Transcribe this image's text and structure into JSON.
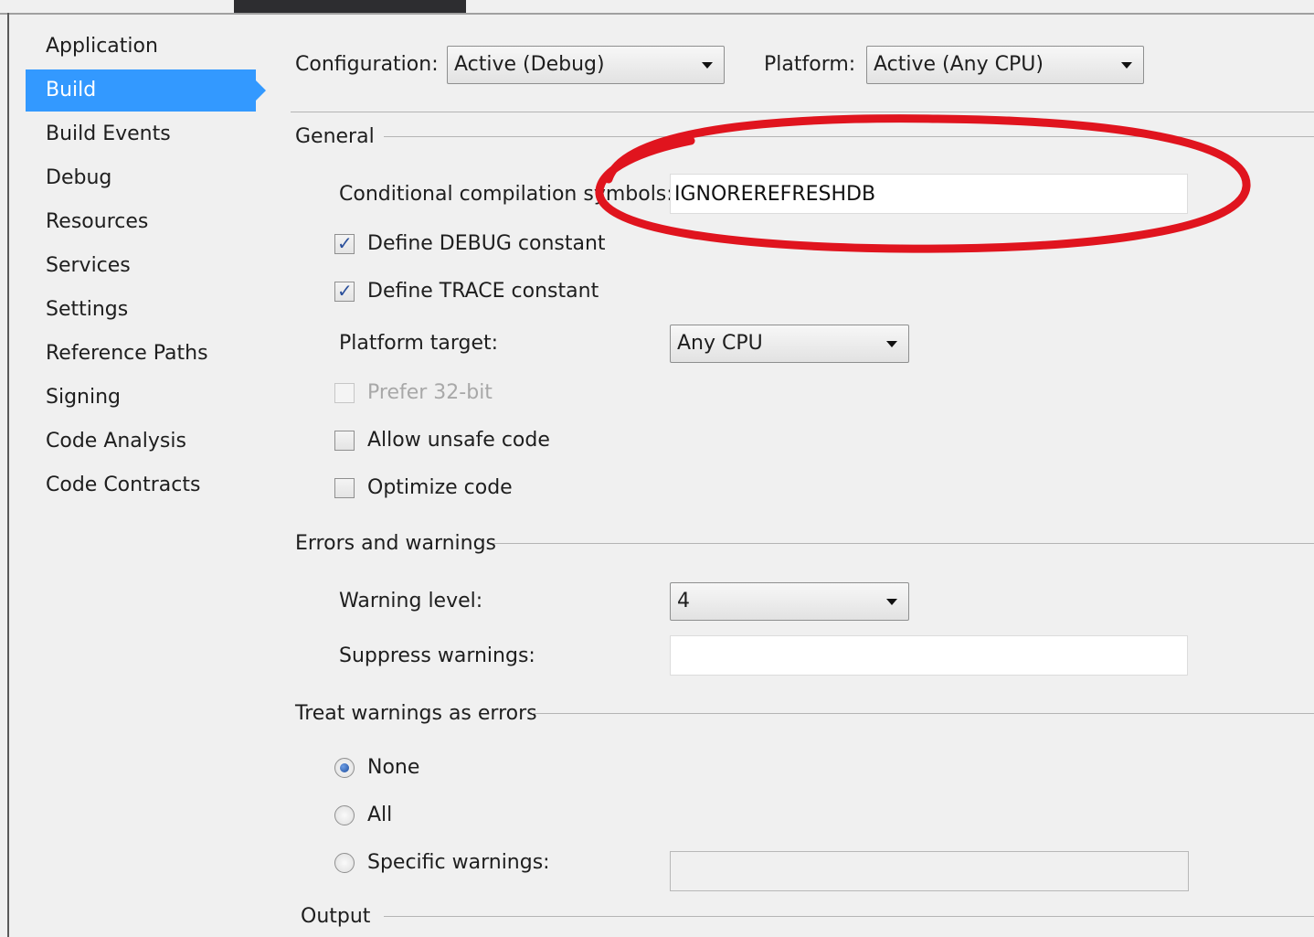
{
  "sidebar": {
    "items": [
      {
        "label": "Application"
      },
      {
        "label": "Build"
      },
      {
        "label": "Build Events"
      },
      {
        "label": "Debug"
      },
      {
        "label": "Resources"
      },
      {
        "label": "Services"
      },
      {
        "label": "Settings"
      },
      {
        "label": "Reference Paths"
      },
      {
        "label": "Signing"
      },
      {
        "label": "Code Analysis"
      },
      {
        "label": "Code Contracts"
      }
    ],
    "selected": "Build"
  },
  "toolbar": {
    "configuration_label": "Configuration:",
    "configuration_value": "Active (Debug)",
    "platform_label": "Platform:",
    "platform_value": "Active (Any CPU)"
  },
  "general": {
    "header": "General",
    "symbols_label": "Conditional compilation symbols:",
    "symbols_value": "IGNOREREFRESHDB",
    "define_debug_label": "Define DEBUG constant",
    "define_debug_checked": true,
    "define_trace_label": "Define TRACE constant",
    "define_trace_checked": true,
    "platform_target_label": "Platform target:",
    "platform_target_value": "Any CPU",
    "prefer32_label": "Prefer 32-bit",
    "prefer32_checked": false,
    "unsafe_label": "Allow unsafe code",
    "unsafe_checked": false,
    "optimize_label": "Optimize code",
    "optimize_checked": false
  },
  "errors": {
    "header": "Errors and warnings",
    "warning_level_label": "Warning level:",
    "warning_level_value": "4",
    "suppress_label": "Suppress warnings:",
    "suppress_value": ""
  },
  "treat": {
    "header": "Treat warnings as errors",
    "none_label": "None",
    "all_label": "All",
    "specific_label": "Specific warnings:",
    "selected": "None",
    "specific_value": ""
  },
  "output": {
    "header": "Output"
  },
  "colors": {
    "selection": "#3399ff",
    "annotation": "#e0141e",
    "background": "#f0f0f0"
  }
}
